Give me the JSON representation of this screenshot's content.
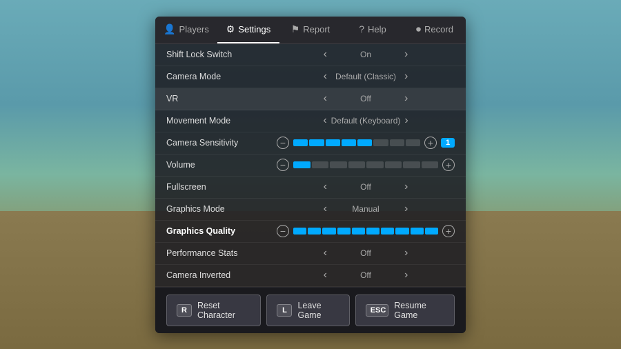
{
  "background": {
    "color": "#5a9aaa"
  },
  "tabs": [
    {
      "id": "players",
      "label": "Players",
      "icon": "👤",
      "active": false
    },
    {
      "id": "settings",
      "label": "Settings",
      "icon": "⚙",
      "active": true
    },
    {
      "id": "report",
      "label": "Report",
      "icon": "⚑",
      "active": false
    },
    {
      "id": "help",
      "label": "Help",
      "icon": "?",
      "active": false
    },
    {
      "id": "record",
      "label": "Record",
      "icon": "⏺",
      "active": false
    }
  ],
  "settings": [
    {
      "label": "Shift Lock Switch",
      "value": "On",
      "type": "arrow",
      "bold": false,
      "highlight": false
    },
    {
      "label": "Camera Mode",
      "value": "Default (Classic)",
      "type": "arrow",
      "bold": false,
      "highlight": false
    },
    {
      "label": "VR",
      "value": "Off",
      "type": "arrow",
      "bold": false,
      "highlight": true
    },
    {
      "label": "Movement Mode",
      "value": "Default (Keyboard)",
      "type": "arrow",
      "bold": false,
      "highlight": false
    },
    {
      "label": "Camera Sensitivity",
      "value": "",
      "type": "slider",
      "segments": 5,
      "filled": 5,
      "total": 8,
      "showNum": true,
      "num": "1",
      "bold": false,
      "highlight": false
    },
    {
      "label": "Volume",
      "value": "",
      "type": "slider",
      "segments": 1,
      "filled": 1,
      "total": 8,
      "showNum": false,
      "num": "",
      "bold": false,
      "highlight": false
    },
    {
      "label": "Fullscreen",
      "value": "Off",
      "type": "arrow",
      "bold": false,
      "highlight": false
    },
    {
      "label": "Graphics Mode",
      "value": "Manual",
      "type": "arrow",
      "bold": false,
      "highlight": false
    },
    {
      "label": "Graphics Quality",
      "value": "",
      "type": "slider",
      "segments": 10,
      "filled": 10,
      "total": 10,
      "showNum": false,
      "num": "",
      "bold": true,
      "highlight": false
    },
    {
      "label": "Performance Stats",
      "value": "Off",
      "type": "arrow",
      "bold": false,
      "highlight": false
    },
    {
      "label": "Camera Inverted",
      "value": "Off",
      "type": "arrow",
      "bold": false,
      "highlight": false
    }
  ],
  "buttons": [
    {
      "key": "R",
      "label": "Reset Character"
    },
    {
      "key": "L",
      "label": "Leave Game"
    },
    {
      "key": "ESC",
      "label": "Resume Game"
    }
  ]
}
